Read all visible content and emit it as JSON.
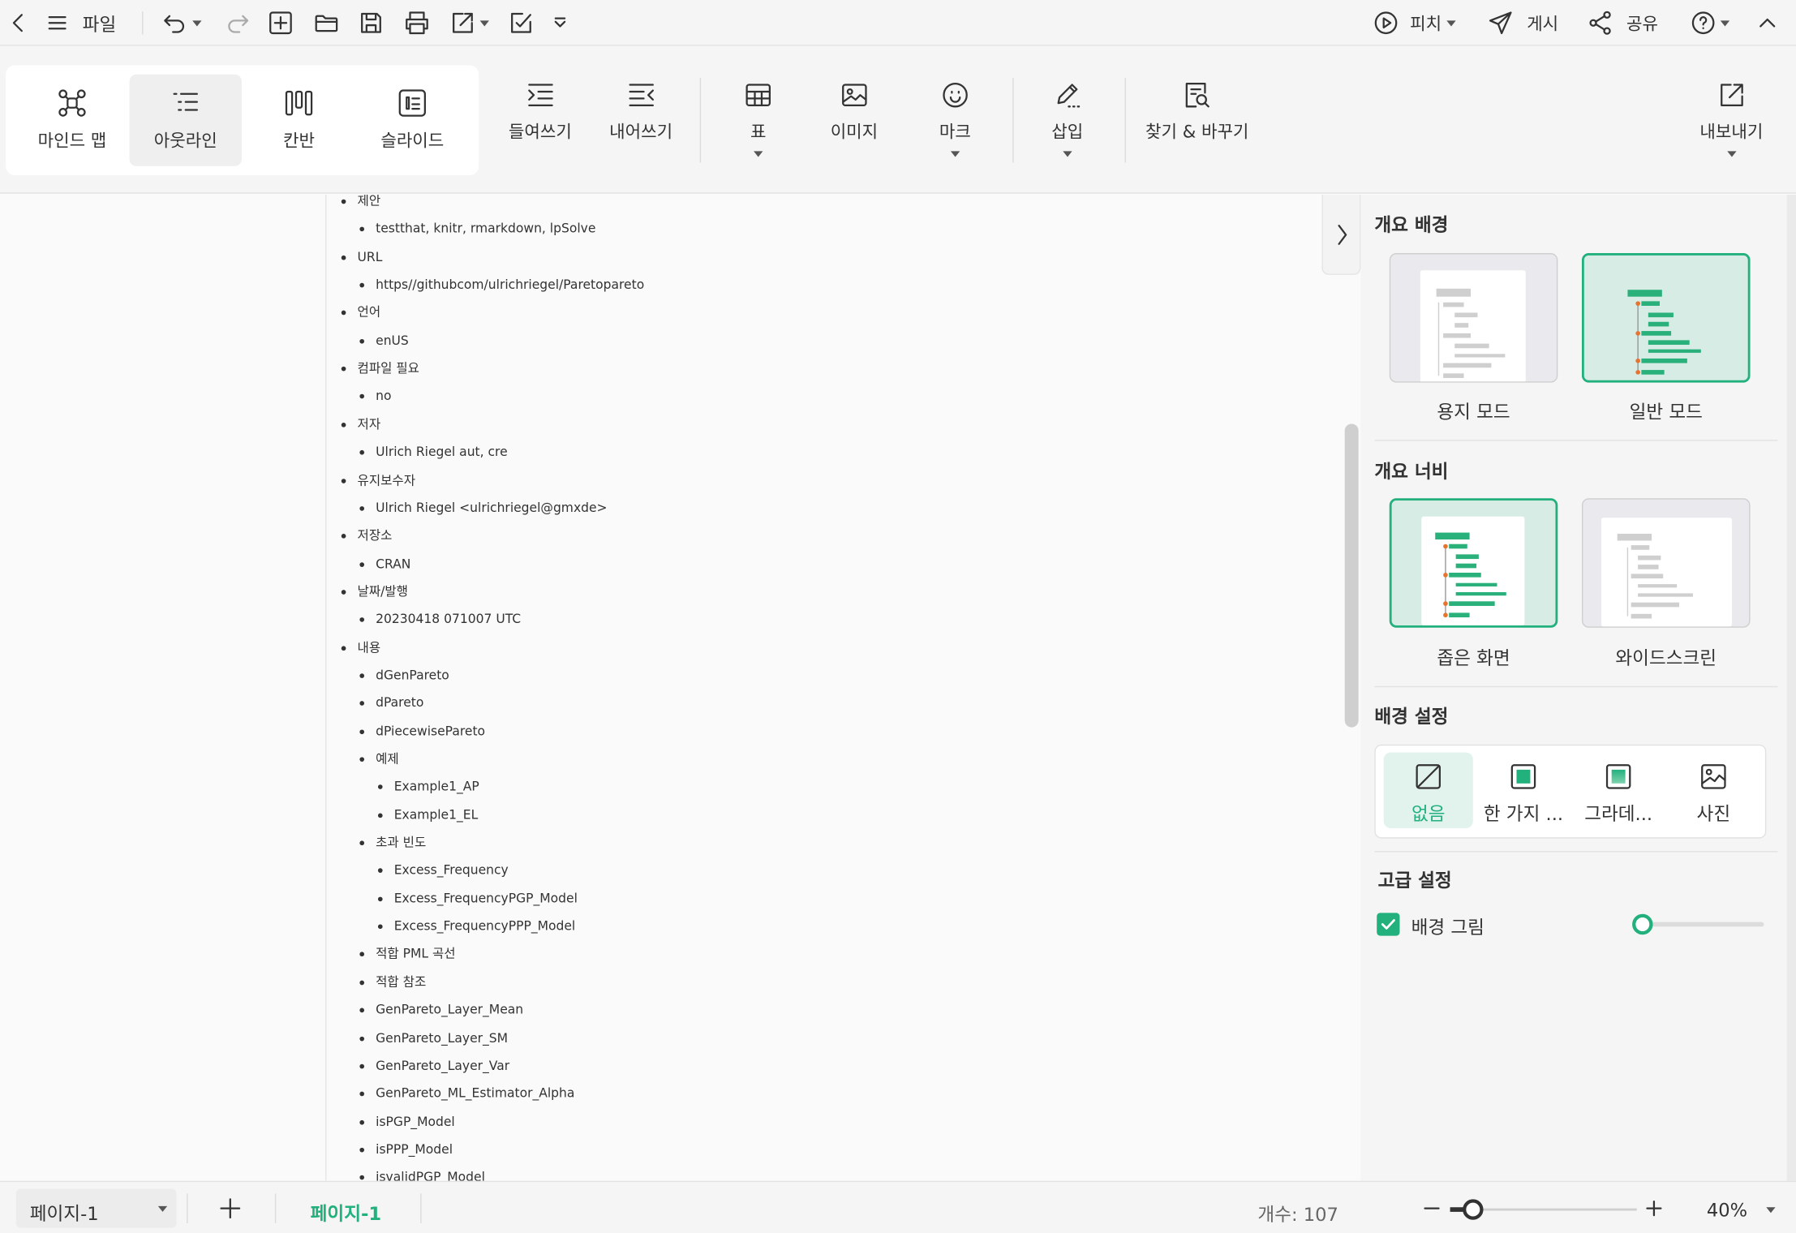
{
  "topbar": {
    "file_label": "파일",
    "pitch_label": "피치",
    "publish_label": "게시",
    "share_label": "공유"
  },
  "ribbon": {
    "views": [
      {
        "label": "마인드 맵",
        "icon": "mindmap-icon"
      },
      {
        "label": "아웃라인",
        "icon": "outline-icon"
      },
      {
        "label": "칸반",
        "icon": "kanban-icon"
      },
      {
        "label": "슬라이드",
        "icon": "slide-icon"
      }
    ],
    "indent_label": "들여쓰기",
    "outdent_label": "내어쓰기",
    "table_label": "표",
    "image_label": "이미지",
    "mark_label": "마크",
    "insert_label": "삽입",
    "find_replace_label": "찾기 & 바꾸기",
    "export_label": "내보내기"
  },
  "outline": [
    {
      "text": "제안",
      "level": 0
    },
    {
      "text": "testthat, knitr, rmarkdown, lpSolve",
      "level": 1
    },
    {
      "text": "URL",
      "level": 0
    },
    {
      "text": "https//githubcom/ulrichriegel/Paretopareto",
      "level": 1
    },
    {
      "text": "언어",
      "level": 0
    },
    {
      "text": "enUS",
      "level": 1
    },
    {
      "text": "컴파일 필요",
      "level": 0
    },
    {
      "text": "no",
      "level": 1
    },
    {
      "text": "저자",
      "level": 0
    },
    {
      "text": "Ulrich Riegel aut, cre",
      "level": 1
    },
    {
      "text": "유지보수자",
      "level": 0
    },
    {
      "text": "Ulrich Riegel <ulrichriegel@gmxde>",
      "level": 1
    },
    {
      "text": "저장소",
      "level": 0
    },
    {
      "text": "CRAN",
      "level": 1
    },
    {
      "text": "날짜/발행",
      "level": 0
    },
    {
      "text": "20230418 071007 UTC",
      "level": 1
    },
    {
      "text": "내용",
      "level": 0
    },
    {
      "text": "dGenPareto",
      "level": 1
    },
    {
      "text": "dPareto",
      "level": 1
    },
    {
      "text": "dPiecewisePareto",
      "level": 1
    },
    {
      "text": "예제",
      "level": 1
    },
    {
      "text": "Example1_AP",
      "level": 2
    },
    {
      "text": "Example1_EL",
      "level": 2
    },
    {
      "text": "초과 빈도",
      "level": 1
    },
    {
      "text": "Excess_Frequency",
      "level": 2
    },
    {
      "text": "Excess_FrequencyPGP_Model",
      "level": 2
    },
    {
      "text": "Excess_FrequencyPPP_Model",
      "level": 2
    },
    {
      "text": "적합 PML 곡선",
      "level": 1
    },
    {
      "text": "적합 참조",
      "level": 1
    },
    {
      "text": "GenPareto_Layer_Mean",
      "level": 1
    },
    {
      "text": "GenPareto_Layer_SM",
      "level": 1
    },
    {
      "text": "GenPareto_Layer_Var",
      "level": 1
    },
    {
      "text": "GenPareto_ML_Estimator_Alpha",
      "level": 1
    },
    {
      "text": "isPGP_Model",
      "level": 1
    },
    {
      "text": "isPPP_Model",
      "level": 1
    },
    {
      "text": "isvalidPGP_Model",
      "level": 1
    }
  ],
  "panel": {
    "bg_title": "개요 배경",
    "paper_mode_label": "용지 모드",
    "normal_mode_label": "일반 모드",
    "width_title": "개요 너비",
    "narrow_label": "좁은 화면",
    "wide_label": "와이드스크린",
    "bg_settings_title": "배경 설정",
    "bg_options": [
      {
        "label": "없음",
        "icon": "none-slash-icon"
      },
      {
        "label": "한 가지 ...",
        "icon": "solid-color-icon"
      },
      {
        "label": "그라데...",
        "icon": "gradient-icon"
      },
      {
        "label": "사진",
        "icon": "photo-icon"
      }
    ],
    "advanced_title": "고급 설정",
    "bg_image_label": "배경 그림",
    "bg_image_checked": true,
    "bg_image_opacity": 0
  },
  "bottombar": {
    "page_select_value": "페이지-1",
    "page_tab_label": "페이지-1",
    "count_label": "개수: 107",
    "zoom_label": "40%",
    "zoom_fraction": 0.12
  },
  "colors": {
    "accent": "#22b07d",
    "bullet_orange": "#e8732c"
  }
}
